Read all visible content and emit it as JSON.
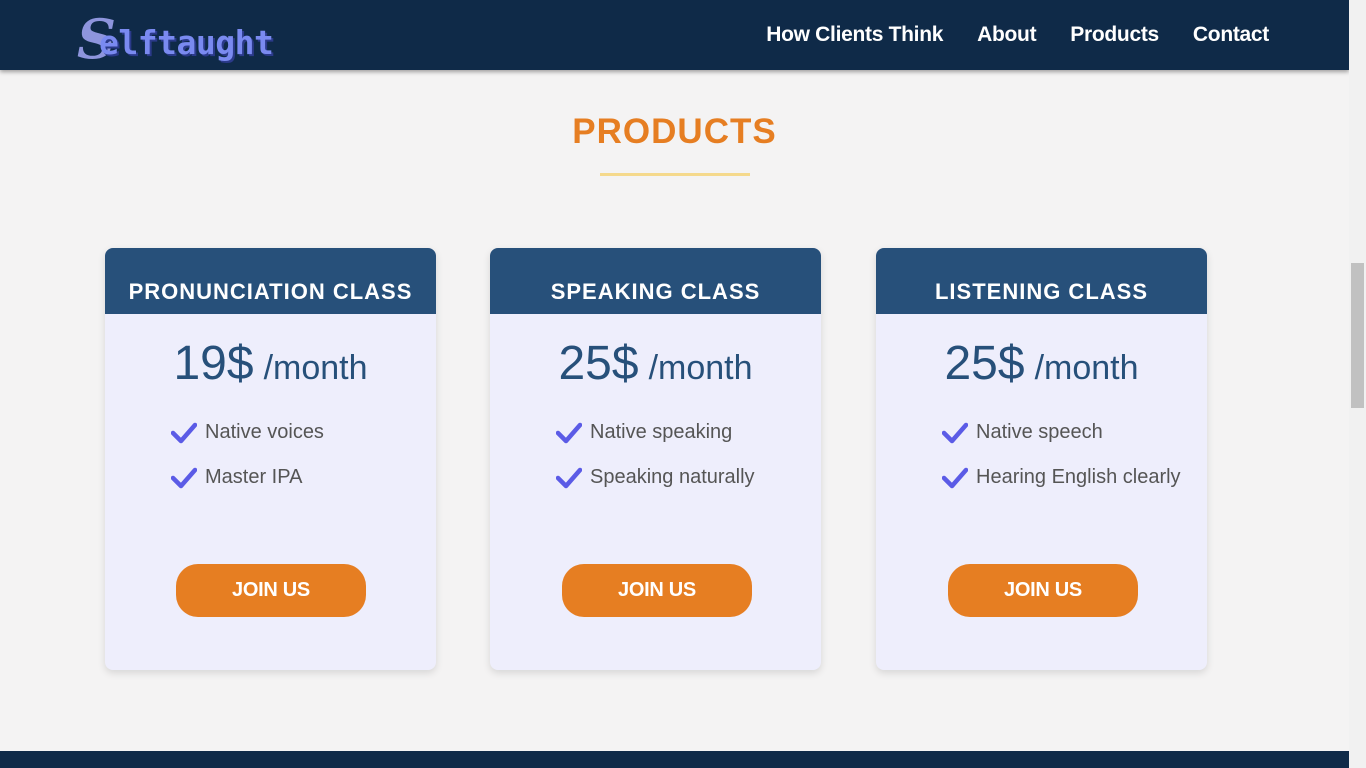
{
  "header": {
    "logo_initial": "S",
    "logo_text": "elftaught",
    "nav": [
      "How Clients Think",
      "About",
      "Products",
      "Contact"
    ]
  },
  "section": {
    "title": "PRODUCTS"
  },
  "cards": [
    {
      "title": "PRONUNCIATION CLASS",
      "price": "19$",
      "period": "/month",
      "features": [
        "Native voices",
        "Master IPA"
      ],
      "button": "JOIN US"
    },
    {
      "title": "SPEAKING CLASS",
      "price": "25$",
      "period": "/month",
      "features": [
        "Native speaking",
        "Speaking naturally"
      ],
      "button": "JOIN US"
    },
    {
      "title": "LISTENING CLASS",
      "price": "25$",
      "period": "/month",
      "features": [
        "Native speech",
        "Hearing English clearly"
      ],
      "button": "JOIN US"
    }
  ],
  "colors": {
    "navbar": "#0f2a48",
    "accent": "#e67e22",
    "card_header": "#27507a",
    "check": "#5b5be6"
  },
  "icons": {
    "feature": "check-icon"
  }
}
